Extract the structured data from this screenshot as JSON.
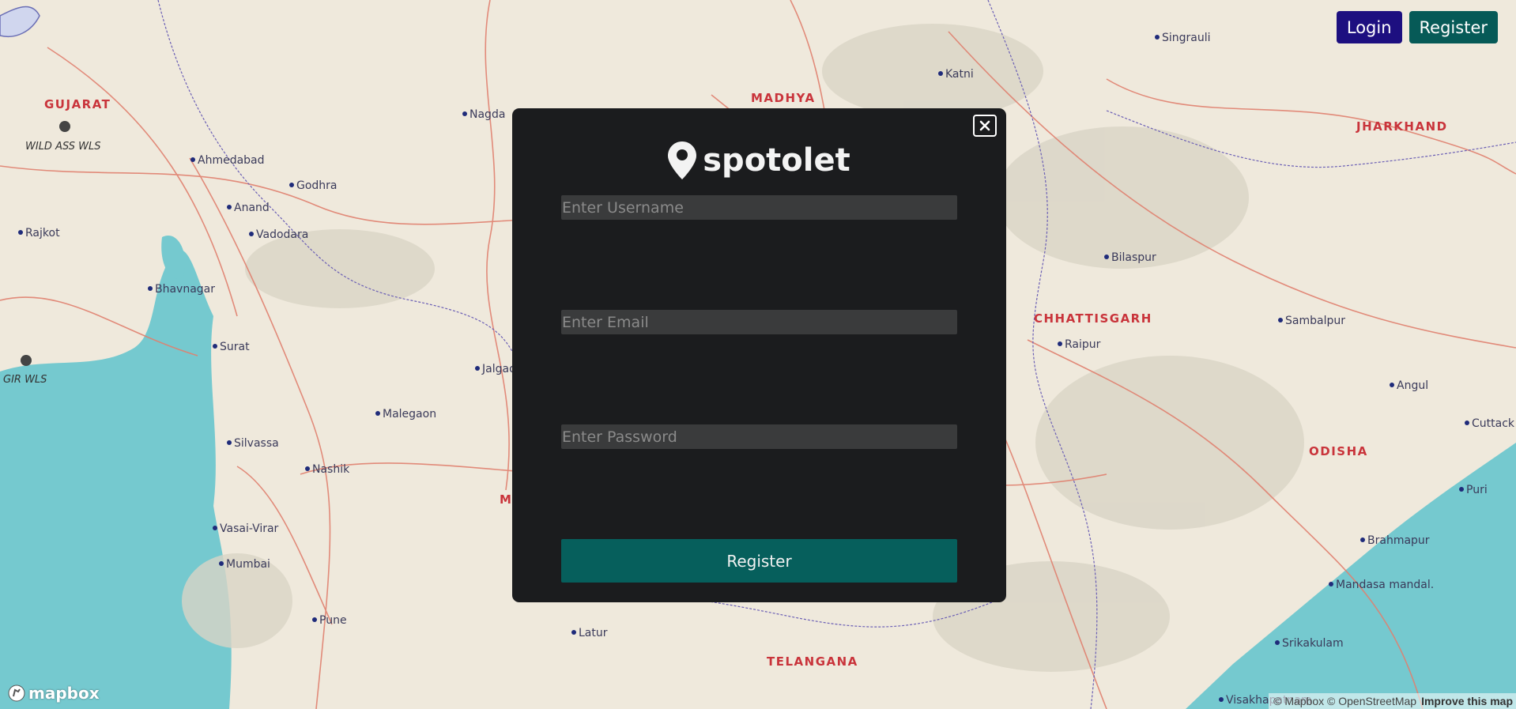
{
  "header": {
    "login_label": "Login",
    "register_label": "Register"
  },
  "modal": {
    "brand_name": "spotolet",
    "username_placeholder": "Enter Username",
    "email_placeholder": "Enter Email",
    "password_placeholder": "Enter Password",
    "submit_label": "Register"
  },
  "map": {
    "region_labels": [
      "GUJARAT",
      "MADHYA",
      "JHARKHAND",
      "CHHATTISGARH",
      "ODISHA",
      "TELANGANA",
      "M"
    ],
    "park_labels": [
      "WILD ASS WLS",
      "GIR WLS"
    ],
    "cities": [
      "Ahmedabad",
      "Anand",
      "Vadodara",
      "Rajkot",
      "Bhavnagar",
      "Godhra",
      "Surat",
      "Silvassa",
      "Nashik",
      "Vasai-Virar",
      "Mumbai",
      "Pune",
      "Malegaon",
      "Jalgaon",
      "Nagda",
      "Katni",
      "Singrauli",
      "Bilaspur",
      "Raipur",
      "Sambalpur",
      "Angul",
      "Cuttack",
      "Puri",
      "Brahmapur",
      "Mandasa mandal.",
      "Srikakulam",
      "Latur",
      "Visakhapatnam"
    ],
    "mapbox_logo": "mapbox",
    "attribution": "© Mapbox © OpenStreetMap",
    "improve_link": "Improve this map"
  },
  "colors": {
    "login": "#1d0f80",
    "register": "#065a57",
    "submit": "#065f5c",
    "modal_bg": "#1b1c1e"
  }
}
